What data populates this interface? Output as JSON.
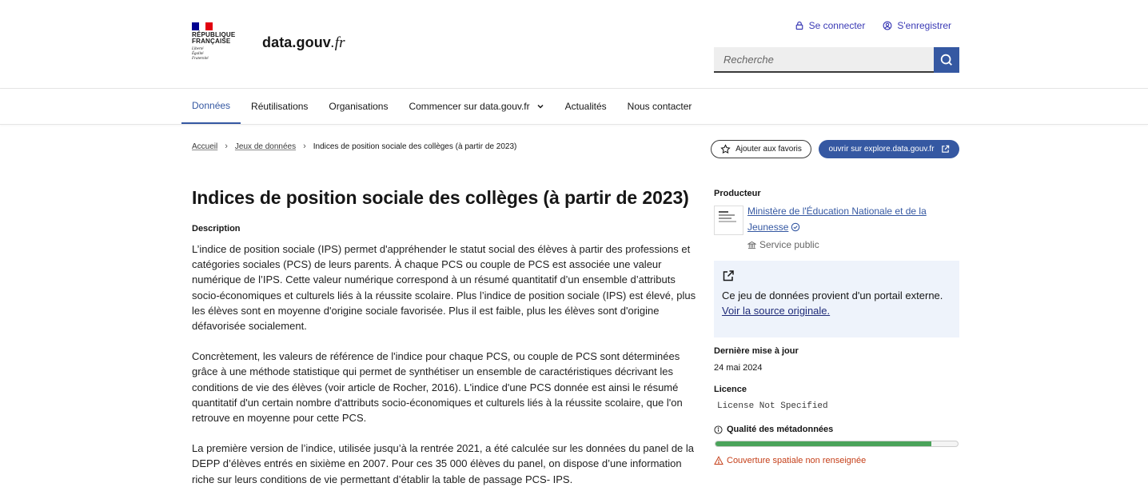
{
  "header": {
    "logo_text": "RÉPUBLIQUE FRANÇAISE",
    "logo_motto": [
      "Liberté",
      "Égalité",
      "Fraternité"
    ],
    "site_name_main": "data.gouv",
    "site_name_tld": ".fr",
    "login_label": "Se connecter",
    "register_label": "S'enregistrer",
    "search_placeholder": "Recherche"
  },
  "nav": {
    "items": [
      {
        "label": "Données",
        "active": true
      },
      {
        "label": "Réutilisations"
      },
      {
        "label": "Organisations"
      },
      {
        "label": "Commencer sur data.gouv.fr",
        "dropdown": true
      },
      {
        "label": "Actualités"
      },
      {
        "label": "Nous contacter"
      }
    ]
  },
  "breadcrumb": {
    "home": "Accueil",
    "datasets": "Jeux de données",
    "current": "Indices de position sociale des collèges (à partir de 2023)"
  },
  "actions": {
    "favorite_label": "Ajouter aux favoris",
    "explore_label": "ouvrir sur explore.data.gouv.fr"
  },
  "dataset": {
    "title": "Indices de position sociale des collèges (à partir de 2023)",
    "description_label": "Description",
    "paragraphs": [
      "L’indice de position sociale (IPS) permet d'appréhender le statut social des élèves à partir des professions et catégories sociales (PCS) de leurs parents. À chaque PCS ou couple de PCS est associée une valeur numérique de l’IPS. Cette valeur numérique correspond à un résumé quantitatif d’un ensemble d’attributs socio-économiques et culturels liés à la réussite scolaire. Plus l’indice de position sociale (IPS) est élevé, plus les élèves sont en moyenne d'origine sociale favorisée. Plus il est faible, plus les élèves sont d'origine défavorisée socialement.",
      "Concrètement, les valeurs de référence de l'indice pour chaque PCS, ou couple de PCS sont déterminées grâce à une méthode statistique qui permet de synthétiser un ensemble de caractéristiques décrivant les conditions de vie des élèves (voir article de Rocher, 2016). L'indice d'une PCS donnée est ainsi le résumé quantitatif d'un certain nombre d'attributs socio-économiques et culturels liés à la réussite scolaire, que l'on retrouve en moyenne pour cette PCS.",
      "La première version de l’indice, utilisée jusqu’à la rentrée 2021, a été calculée sur les données du panel de la DEPP d’élèves entrés en sixième en 2007. Pour ces 35 000 élèves du panel, on dispose d’une information riche sur leurs conditions de vie permettant d’établir la table de passage PCS- IPS."
    ]
  },
  "sidebar": {
    "producer_label": "Producteur",
    "producer_name": "Ministère de l'Éducation Nationale et de la Jeunesse",
    "producer_type": "Service public",
    "external_text": "Ce jeu de données provient d'un portail externe.",
    "external_link": "Voir la source originale.",
    "last_update_label": "Dernière mise à jour",
    "last_update_value": "24 mai 2024",
    "license_label": "Licence",
    "license_value": "License Not Specified",
    "quality_label": "Qualité des métadonnées",
    "quality_score": 0.89,
    "quality_warning": "Couverture spatiale non renseignée"
  },
  "colors": {
    "primary": "#3558a2",
    "quality_bar": "#4aa35a",
    "warning": "#c5401a",
    "flag_blue": "#000091",
    "flag_red": "#e1000f"
  }
}
